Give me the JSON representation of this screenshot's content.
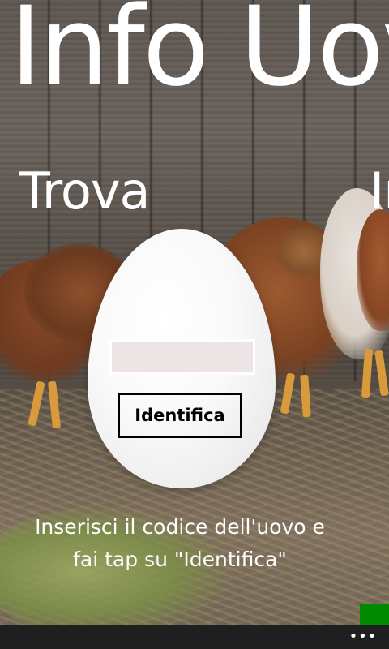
{
  "panorama": {
    "title": "Info Uovo",
    "section_current": "Trova",
    "section_next": "Info"
  },
  "form": {
    "code_input_value": "",
    "code_input_placeholder": "",
    "identify_button_label": "Identifica"
  },
  "instruction": {
    "line1": "Inserisci il codice dell'uovo e",
    "line2": "fai tap su \"Identifica\""
  },
  "app_bar": {
    "more_label": "•••",
    "more_icon": "ellipsis-icon"
  },
  "colors": {
    "text": "#ffffff",
    "accent": "#008a00",
    "app_bar_background": "#1f1f1f",
    "input_background": "#ede5e5",
    "egg": "#f5f5f5"
  }
}
